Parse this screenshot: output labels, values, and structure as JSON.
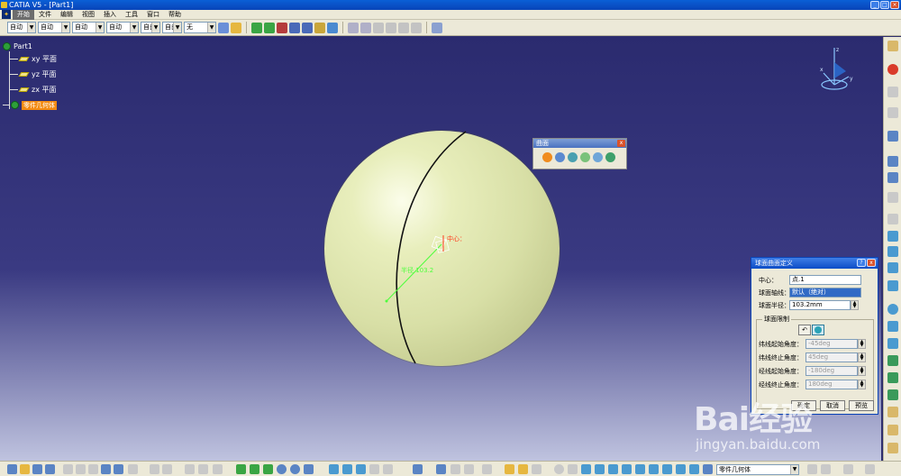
{
  "window": {
    "title": "CATIA V5 - [Part1]"
  },
  "menu": {
    "logo": "开始",
    "items": [
      "文件",
      "编辑",
      "视图",
      "插入",
      "工具",
      "窗口",
      "帮助"
    ]
  },
  "toolbar_top": {
    "combos": [
      {
        "value": "自动",
        "width": 32
      },
      {
        "value": "自动",
        "width": 36
      },
      {
        "value": "自动",
        "width": 36
      },
      {
        "value": "自动",
        "width": 36
      },
      {
        "value": "自由",
        "width": 22
      },
      {
        "value": "自由",
        "width": 22
      },
      {
        "value": "无",
        "width": 36
      }
    ]
  },
  "tree": {
    "root": "Part1",
    "items": [
      {
        "label": "xy 平面"
      },
      {
        "label": "yz 平面"
      },
      {
        "label": "zx 平面"
      }
    ],
    "body": "零件几何体"
  },
  "viewport": {
    "center_label": "中心：",
    "radius_label": "半径 103.2"
  },
  "float_toolbar": {
    "title": "曲面",
    "close": "x"
  },
  "dialog": {
    "title": "球面曲面定义",
    "help": "?",
    "close": "x",
    "center_label": "中心：",
    "center_value": "点.1",
    "axis_label": "球面轴线：",
    "axis_value": "默认（绝对）",
    "radius_label": "球面半径：",
    "radius_value": "103.2mm",
    "limits_group": "球面限制",
    "parallel_start_label": "纬线起始角度：",
    "parallel_start_value": "-45deg",
    "parallel_end_label": "纬线终止角度：",
    "parallel_end_value": "45deg",
    "meridian_start_label": "经线起始角度：",
    "meridian_start_value": "-180deg",
    "meridian_end_label": "经线终止角度：",
    "meridian_end_value": "180deg",
    "ok": "确定",
    "cancel": "取消",
    "preview": "预览"
  },
  "bottom_toolbar": {
    "combo_value": "零件几何体"
  },
  "watermark": {
    "main": "Bai经验",
    "sub": "jingyan.baidu.com"
  },
  "colors": {
    "sphere": "#d8dfa6",
    "selection": "#f38b12",
    "background_top": "#2b2b6f",
    "background_bottom": "#bfc3df"
  }
}
